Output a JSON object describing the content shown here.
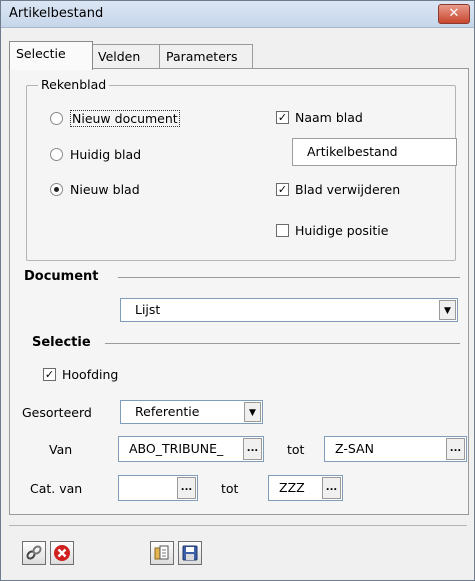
{
  "window": {
    "title": "Artikelbestand",
    "close_symbol": "✕"
  },
  "tabs": [
    {
      "label": "Selectie",
      "active": true
    },
    {
      "label": "Velden",
      "active": false
    },
    {
      "label": "Parameters",
      "active": false
    }
  ],
  "rekenblad": {
    "label": "Rekenblad",
    "radios": [
      {
        "label": "Nieuw document",
        "selected": false
      },
      {
        "label": "Huidig blad",
        "selected": false
      },
      {
        "label": "Nieuw blad",
        "selected": true
      }
    ],
    "naam_blad": {
      "label": "Naam blad",
      "checked": true,
      "value": "Artikelbestand"
    },
    "blad_verwijderen": {
      "label": "Blad verwijderen",
      "checked": true
    },
    "huidige_positie": {
      "label": "Huidige positie",
      "checked": false
    }
  },
  "document": {
    "label": "Document",
    "selected": "Lijst"
  },
  "selectie": {
    "label": "Selectie",
    "hoofding": {
      "label": "Hoofding",
      "checked": true
    },
    "gesorteerd": {
      "label": "Gesorteerd",
      "selected": "Referentie"
    },
    "van": {
      "label": "Van",
      "value": "ABO_TRIBUNE_",
      "button": "...",
      "tot_label": "tot",
      "tot_value": "Z-SAN",
      "tot_button": "..."
    },
    "cat_van": {
      "label": "Cat. van",
      "value": "",
      "button": "...",
      "tot_label": "tot",
      "tot_value": "ZZZ",
      "tot_button": "..."
    }
  },
  "toolbar": {
    "icons": [
      "link-icon",
      "close-circle-icon",
      "folder-copy-icon",
      "save-icon"
    ]
  },
  "colors": {
    "close_button": "#c7462f",
    "close_icon_red": "#d02020"
  }
}
